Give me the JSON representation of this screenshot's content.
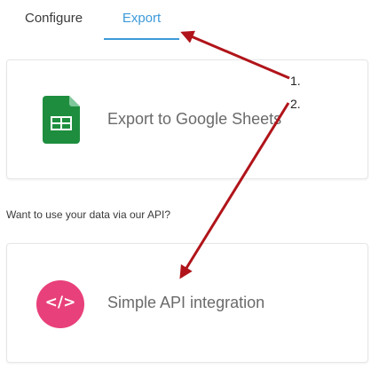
{
  "tabs": [
    {
      "label": "Configure",
      "active": false
    },
    {
      "label": "Export",
      "active": true
    }
  ],
  "sheets_card": {
    "label": "Export to Google Sheets",
    "icon": "google-sheets-icon"
  },
  "api_section": {
    "question": "Want to use your data via our API?"
  },
  "api_card": {
    "label": "Simple API integration",
    "icon": "code-icon",
    "icon_glyph": "</>"
  },
  "annotations": {
    "one": "1.",
    "two": "2."
  },
  "colors": {
    "accent": "#3d9ad9",
    "sheets_green": "#1e8e3e",
    "api_pink": "#e8407a",
    "arrow_red": "#b0141a"
  }
}
